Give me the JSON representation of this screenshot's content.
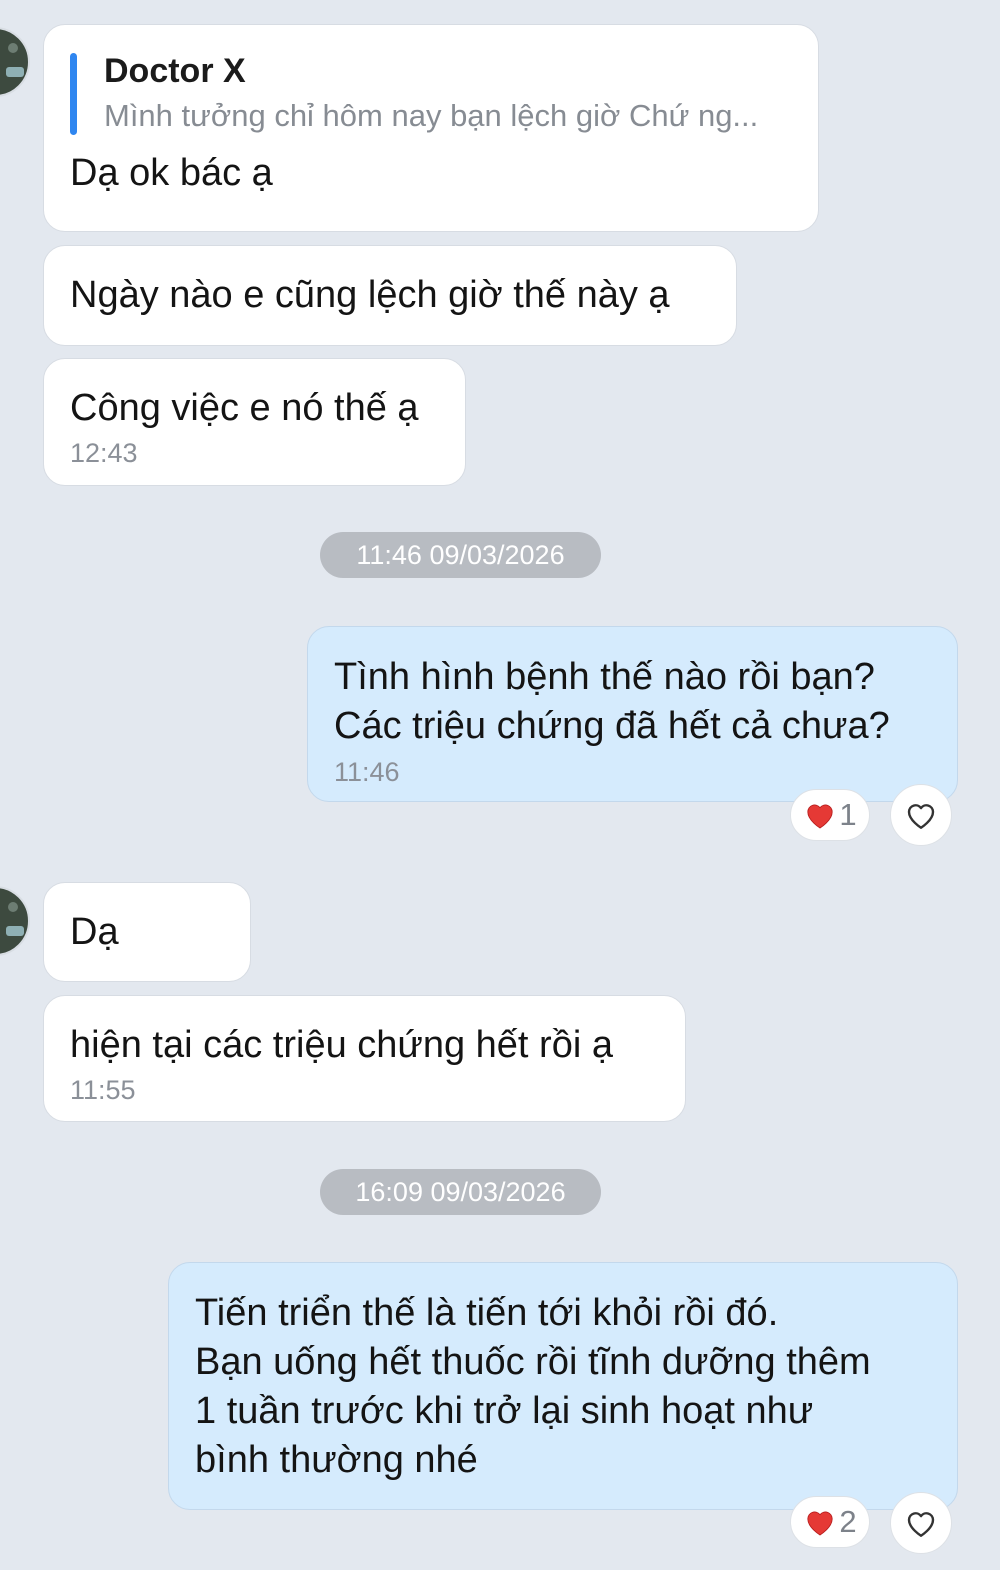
{
  "thread": {
    "block1": {
      "quote": {
        "name": "Doctor X",
        "text": "Mình tưởng chỉ hôm nay bạn lệch giờ Chứ ng..."
      },
      "messages": [
        {
          "text": "Dạ ok bác ạ"
        },
        {
          "text": "Ngày nào e cũng lệch giờ thế này ạ"
        },
        {
          "text": "Công việc e nó thế ạ",
          "time": "12:43"
        }
      ]
    },
    "divider1": "11:46 09/03/2026",
    "outgoing1": {
      "lines": [
        "Tình hình bệnh thế nào rồi bạn?",
        "Các triệu chứng đã hết cả chưa?"
      ],
      "time": "11:46",
      "reaction": {
        "icon": "red-heart-icon",
        "count": "1"
      }
    },
    "block2": {
      "messages": [
        {
          "text": "Dạ"
        },
        {
          "text": "hiện tại các triệu chứng hết rồi ạ",
          "time": "11:55"
        }
      ]
    },
    "divider2": "16:09 09/03/2026",
    "outgoing2": {
      "lines": [
        "Tiến triển thế là tiến tới khỏi rồi đó.",
        "Bạn uống hết thuốc rồi tĩnh dưỡng thêm",
        "1 tuần trước khi trở lại sinh hoạt như",
        "bình thường nhé"
      ],
      "reaction": {
        "icon": "red-heart-icon",
        "count": "2"
      }
    }
  },
  "colors": {
    "background": "#e3e8ef",
    "incoming_bubble": "#ffffff",
    "outgoing_bubble": "#d5ebfd",
    "quote_accent": "#2f86f0",
    "reaction_heart": "#e53935"
  }
}
